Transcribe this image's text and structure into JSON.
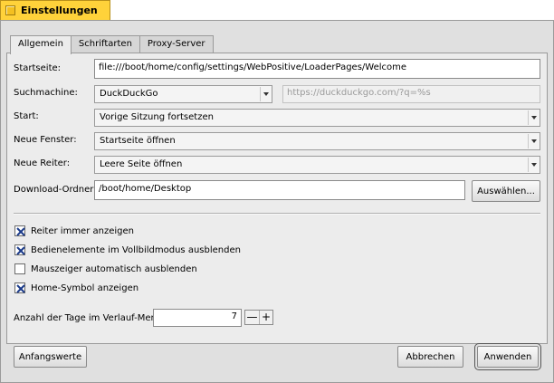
{
  "window": {
    "title": "Einstellungen"
  },
  "tabs": [
    "Allgemein",
    "Schriftarten",
    "Proxy-Server"
  ],
  "fields": {
    "startseite": {
      "label": "Startseite:",
      "value": "file:///boot/home/config/settings/WebPositive/LoaderPages/Welcome"
    },
    "suchmachine": {
      "label": "Suchmachine:",
      "value": "DuckDuckGo",
      "placeholder": "https://duckduckgo.com/?q=%s"
    },
    "start": {
      "label": "Start:",
      "value": "Vorige Sitzung fortsetzen"
    },
    "neue_fenster": {
      "label": "Neue Fenster:",
      "value": "Startseite öffnen"
    },
    "neue_reiter": {
      "label": "Neue Reiter:",
      "value": "Leere Seite öffnen"
    },
    "download": {
      "label": "Download-Ordner:",
      "value": "/boot/home/Desktop",
      "button": "Auswählen..."
    }
  },
  "checks": [
    {
      "label": "Reiter immer anzeigen",
      "checked": true
    },
    {
      "label": "Bedienelemente im Vollbildmodus ausblenden",
      "checked": true
    },
    {
      "label": "Mauszeiger automatisch ausblenden",
      "checked": false
    },
    {
      "label": "Home-Symbol anzeigen",
      "checked": true
    }
  ],
  "history": {
    "label": "Anzahl der Tage im Verlauf-Menü:",
    "value": "7",
    "minus": "—",
    "plus": "+"
  },
  "buttons": {
    "defaults": "Anfangswerte",
    "cancel": "Abbrechen",
    "apply": "Anwenden"
  },
  "colors": {
    "title_tab": "#ffd23a",
    "panel": "#ececec"
  }
}
